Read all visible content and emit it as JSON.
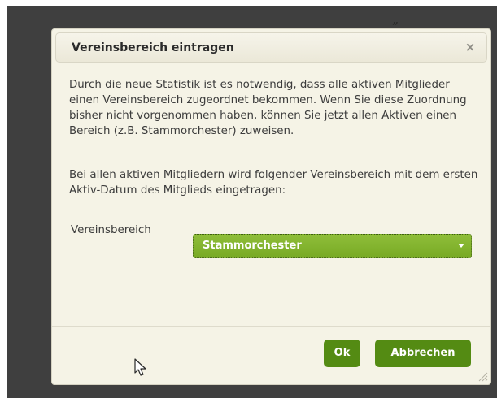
{
  "top_glyph": "„",
  "dialog": {
    "title": "Vereinsbereich eintragen",
    "close_symbol": "×",
    "paragraph_1": "Durch die neue Statistik ist es notwendig, dass alle aktiven Mitglieder einen Vereinsbereich zugeordnet bekommen. Wenn Sie diese Zuordnung bisher nicht vorgenommen haben, können Sie jetzt allen Aktiven einen Bereich (z.B. Stammorchester) zuweisen.",
    "paragraph_2": "Bei allen aktiven Mitgliedern wird folgender Vereinsbereich mit dem ersten Aktiv-Datum des Mitglieds eingetragen:",
    "field_label": "Vereinsbereich",
    "select_value": "Stammorchester",
    "ok_label": "Ok",
    "cancel_label": "Abbrechen"
  },
  "colors": {
    "backdrop": "#3f3f3f",
    "dialog_bg": "#f5f3e6",
    "accent_green": "#548b13",
    "select_green": "#83b42f"
  },
  "icons": {
    "close": "close-icon",
    "dropdown": "chevron-down-icon",
    "resize": "resize-grip-icon",
    "cursor": "mouse-pointer-icon"
  }
}
